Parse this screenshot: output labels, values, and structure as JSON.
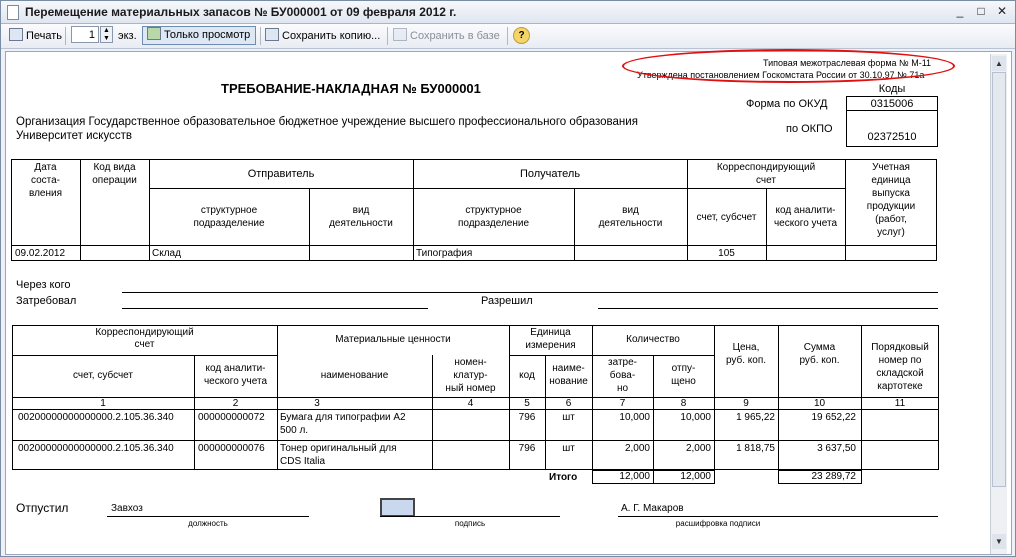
{
  "window": {
    "title": "Перемещение материальных запасов № БУ000001 от 09 февраля 2012 г."
  },
  "toolbar": {
    "print": "Печать",
    "copies": "1",
    "copies_unit": "экз.",
    "view_only": "Только просмотр",
    "save_copy": "Сохранить копию...",
    "save_db": "Сохранить в базе",
    "help": "?"
  },
  "form": {
    "standard_form": "Типовая межотраслевая форма № М-11",
    "approved": "Утверждена постановлением Госкомстата России от 30.10.97 № 71а",
    "title": "ТРЕБОВАНИЕ-НАКЛАДНАЯ № БУ000001",
    "codes_label": "Коды",
    "okud_label": "Форма по ОКУД",
    "okud_value": "0315006",
    "okpo_label": "по ОКПО",
    "okpo_value": "02372510",
    "org_line1": "Организация Государственное образовательное бюджетное учреждение высшего профессионального образования",
    "org_line2": "Университет искусств"
  },
  "head_table": {
    "date_l1": "Дата",
    "date_l2": "соста-",
    "date_l3": "вления",
    "op_l1": "Код вида",
    "op_l2": "операции",
    "sender": "Отправитель",
    "receiver": "Получатель",
    "corr_l1": "Корреспондирующий",
    "corr_l2": "счет",
    "unit_l1": "Учетная",
    "unit_l2": "единица",
    "unit_l3": "выпуска",
    "unit_l4": "продукции",
    "unit_l5": "(работ,",
    "unit_l6": "услуг)",
    "struct_l1": "структурное",
    "struct_l2": "подразделение",
    "activity_l1": "вид",
    "activity_l2": "деятельности",
    "account_sub": "счет, субсчет",
    "analytic_l1": "код аналити-",
    "analytic_l2": "ческого учета",
    "row": {
      "date": "09.02.2012",
      "sender_unit": "Склад",
      "receiver_unit": "Типография",
      "account": "105"
    }
  },
  "through": {
    "via": "Через кого",
    "requested": "Затребовал",
    "allowed": "Разрешил"
  },
  "items_table": {
    "corr_l1": "Корреспондирующий",
    "corr_l2": "счет",
    "values": "Материальные ценности",
    "unit_l1": "Единица",
    "unit_l2": "измерения",
    "qty": "Количество",
    "price_l1": "Цена,",
    "price_l2": "руб. коп.",
    "sum_l1": "Сумма",
    "sum_l2": "руб. коп.",
    "seq_l1": "Порядковый",
    "seq_l2": "номер по",
    "seq_l3": "складской",
    "seq_l4": "картотеке",
    "acc_sub": "счет, субсчет",
    "analytic_l1": "код аналити-",
    "analytic_l2": "ческого учета",
    "name": "наименование",
    "nomen_l1": "номен-",
    "nomen_l2": "клатур-",
    "nomen_l3": "ный номер",
    "code": "код",
    "uname_l1": "наиме-",
    "uname_l2": "нование",
    "req_l1": "затре-",
    "req_l2": "бова-",
    "req_l3": "но",
    "rel_l1": "отпу-",
    "rel_l2": "щено",
    "colnums": [
      "1",
      "2",
      "3",
      "4",
      "5",
      "6",
      "7",
      "8",
      "9",
      "10",
      "11"
    ],
    "rows": [
      {
        "account": "00200000000000000.2.105.36.340",
        "analytic": "000000000072",
        "name_l1": "Бумага для типографии А2",
        "name_l2": "500 л.",
        "code": "796",
        "unit": "шт",
        "requested": "10,000",
        "released": "10,000",
        "price": "1 965,22",
        "sum": "19 652,22"
      },
      {
        "account": "00200000000000000.2.105.36.340",
        "analytic": "000000000076",
        "name_l1": "Тонер оригинальный для",
        "name_l2": "CDS Italia",
        "code": "796",
        "unit": "шт",
        "requested": "2,000",
        "released": "2,000",
        "price": "1 818,75",
        "sum": "3 637,50"
      }
    ],
    "total_label": "Итого",
    "total_requested": "12,000",
    "total_released": "12,000",
    "total_sum": "23 289,72"
  },
  "release": {
    "label": "Отпустил",
    "position": "Завхоз",
    "position_caption": "должность",
    "signature_caption": "подпись",
    "name": "А. Г. Макаров",
    "name_caption": "расшифровка подписи"
  }
}
